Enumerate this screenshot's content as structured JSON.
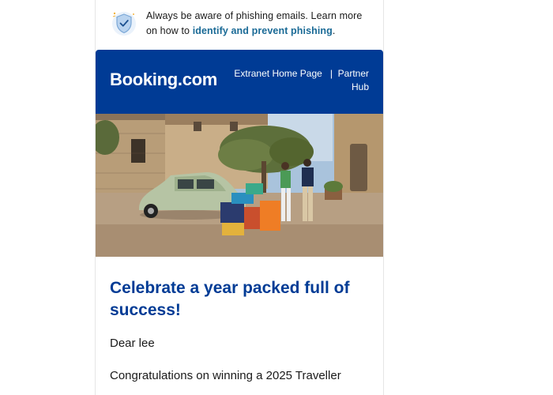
{
  "banner": {
    "text_before": "Always be aware of phishing emails. Learn more on how to ",
    "link": "identify and prevent phishing",
    "text_after": "."
  },
  "header": {
    "logo": "Booking.com",
    "nav_extranet": "Extranet Home Page",
    "nav_separator": "|",
    "nav_partner_hub": "Partner Hub"
  },
  "body": {
    "headline": "Celebrate a year packed full of success!",
    "greeting": "Dear lee",
    "congrats": "Congratulations on winning a 2025 Traveller"
  },
  "colors": {
    "brand_blue": "#003b95",
    "link": "#1a6a96"
  }
}
